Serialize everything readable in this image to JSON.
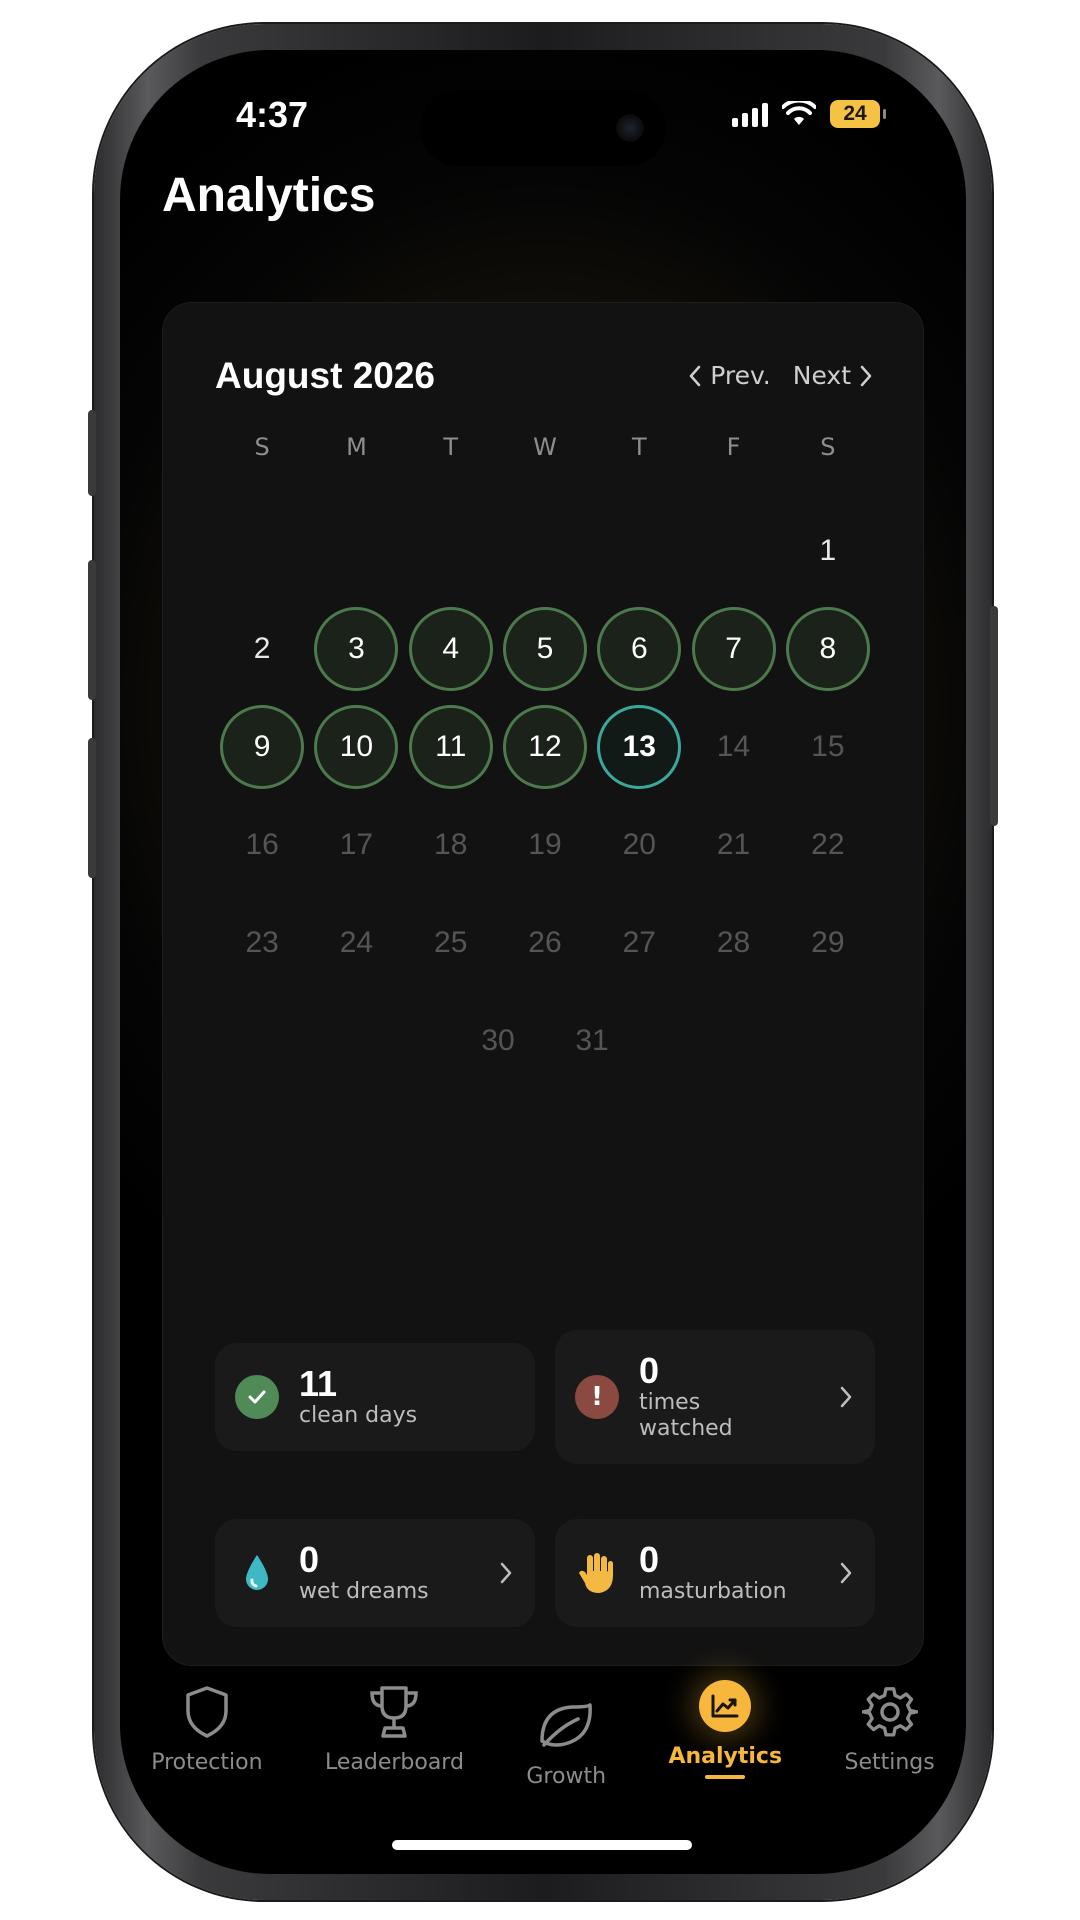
{
  "status_bar": {
    "time": "4:37",
    "battery": "24"
  },
  "page": {
    "title": "Analytics"
  },
  "calendar": {
    "month": "August 2026",
    "prev_label": "Prev.",
    "next_label": "Next",
    "weekdays": [
      "S",
      "M",
      "T",
      "W",
      "T",
      "F",
      "S"
    ],
    "weeks": [
      [
        {
          "d": "",
          "s": "empty"
        },
        {
          "d": "",
          "s": "empty"
        },
        {
          "d": "",
          "s": "empty"
        },
        {
          "d": "",
          "s": "empty"
        },
        {
          "d": "",
          "s": "empty"
        },
        {
          "d": "",
          "s": "empty"
        },
        {
          "d": "1",
          "s": "normal"
        }
      ],
      [
        {
          "d": "2",
          "s": "normal"
        },
        {
          "d": "3",
          "s": "clean"
        },
        {
          "d": "4",
          "s": "clean"
        },
        {
          "d": "5",
          "s": "clean"
        },
        {
          "d": "6",
          "s": "clean"
        },
        {
          "d": "7",
          "s": "clean"
        },
        {
          "d": "8",
          "s": "clean"
        }
      ],
      [
        {
          "d": "9",
          "s": "clean"
        },
        {
          "d": "10",
          "s": "clean"
        },
        {
          "d": "11",
          "s": "clean"
        },
        {
          "d": "12",
          "s": "clean"
        },
        {
          "d": "13",
          "s": "today"
        },
        {
          "d": "14",
          "s": "future"
        },
        {
          "d": "15",
          "s": "future"
        }
      ],
      [
        {
          "d": "16",
          "s": "future"
        },
        {
          "d": "17",
          "s": "future"
        },
        {
          "d": "18",
          "s": "future"
        },
        {
          "d": "19",
          "s": "future"
        },
        {
          "d": "20",
          "s": "future"
        },
        {
          "d": "21",
          "s": "future"
        },
        {
          "d": "22",
          "s": "future"
        }
      ],
      [
        {
          "d": "23",
          "s": "future"
        },
        {
          "d": "24",
          "s": "future"
        },
        {
          "d": "25",
          "s": "future"
        },
        {
          "d": "26",
          "s": "future"
        },
        {
          "d": "27",
          "s": "future"
        },
        {
          "d": "28",
          "s": "future"
        },
        {
          "d": "29",
          "s": "future"
        }
      ]
    ],
    "last_week": [
      "30",
      "31"
    ]
  },
  "stats": {
    "clean": {
      "value": "11",
      "label": "clean days"
    },
    "watched": {
      "value": "0",
      "label_line1": "times",
      "label_line2": "watched"
    },
    "wet_dreams": {
      "value": "0",
      "label": "wet dreams"
    },
    "masturbation": {
      "value": "0",
      "label": "masturbation"
    }
  },
  "tabbar": {
    "protection": "Protection",
    "leaderboard": "Leaderboard",
    "growth": "Growth",
    "analytics": "Analytics",
    "settings": "Settings"
  },
  "colors": {
    "clean_ring": "#4d7a4d",
    "today_ring": "#3ba89c",
    "accent": "#f6b73c",
    "check_green": "#4f8a57",
    "alert_red": "#8a4a42"
  },
  "icons": [
    "shield-icon",
    "trophy-icon",
    "leaf-icon",
    "chart-icon",
    "gear-icon",
    "check-icon",
    "exclamation-icon",
    "droplet-icon",
    "hand-icon",
    "chevron-right-icon",
    "chevron-left-icon"
  ]
}
